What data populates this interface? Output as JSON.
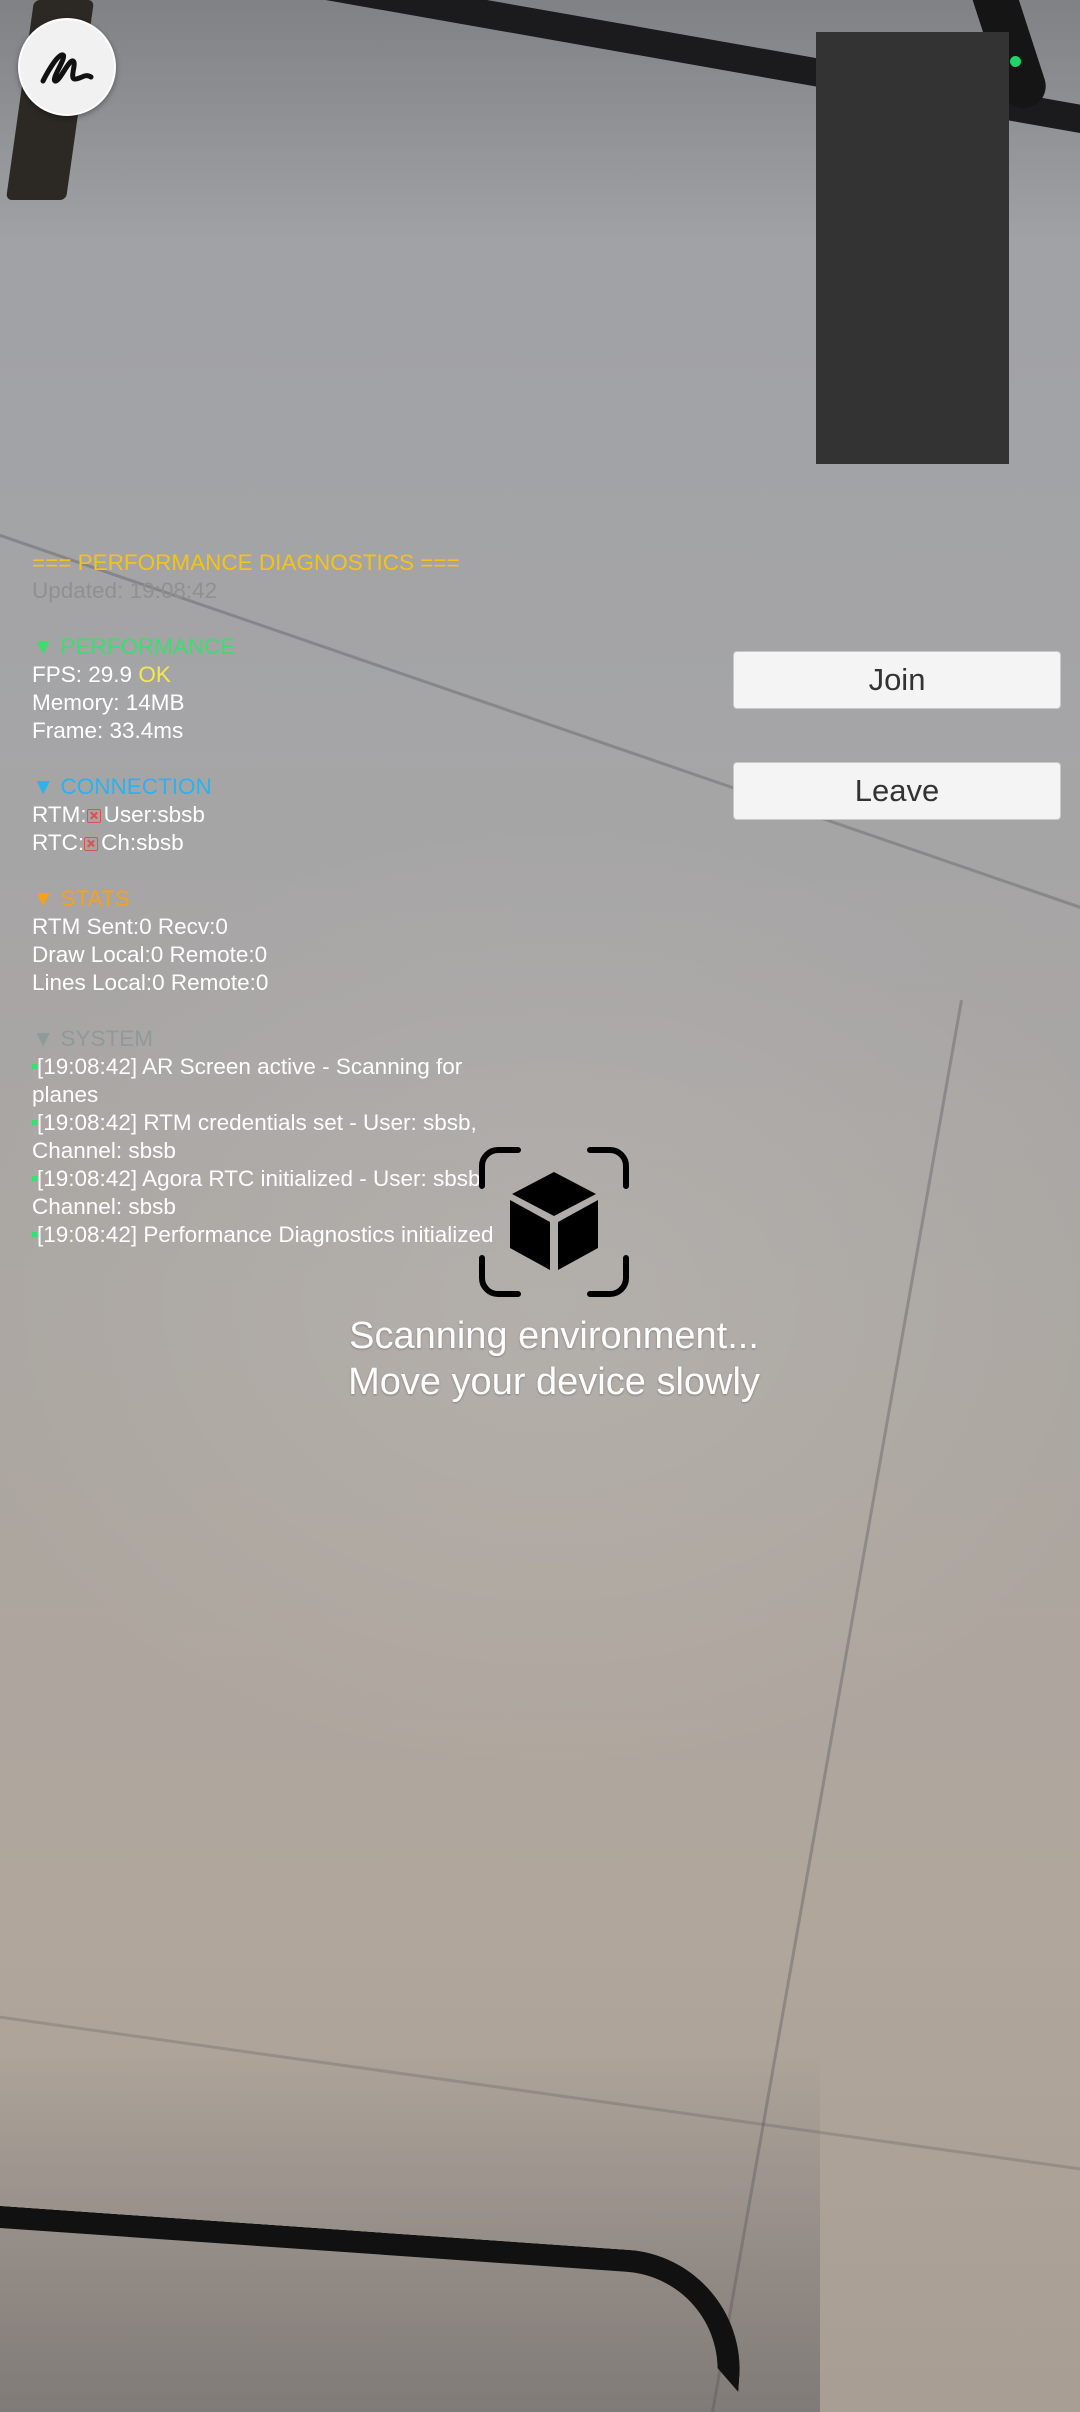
{
  "diagnostics": {
    "header": "=== PERFORMANCE DIAGNOSTICS ===",
    "updated": "Updated: 19:08:42",
    "performance": {
      "heading": "▼ PERFORMANCE",
      "fps_label": "FPS: 29.9",
      "fps_status": "OK",
      "memory": "Memory: 14MB",
      "frame": "Frame: 33.4ms"
    },
    "connection": {
      "heading": "▼ CONNECTION",
      "rtm_label": "RTM:",
      "rtm_value": "User:sbsb",
      "rtc_label": "RTC:",
      "rtc_value": "Ch:sbsb"
    },
    "stats": {
      "heading": "▼ STATS",
      "rtm": "RTM Sent:0 Recv:0",
      "draw": "Draw Local:0 Remote:0",
      "lines": "Lines Local:0 Remote:0"
    },
    "system": {
      "heading": "▼ SYSTEM",
      "logs": [
        "[19:08:42] AR Screen active - Scanning for planes",
        "[19:08:42] RTM credentials set - User: sbsb, Channel: sbsb",
        "[19:08:42] Agora RTC initialized - User: sbsb, Channel: sbsb",
        "[19:08:42] Performance Diagnostics initialized"
      ]
    }
  },
  "buttons": {
    "join": "Join",
    "leave": "Leave"
  },
  "scan": {
    "icon": "ar-cube-scan-icon",
    "line1": "Scanning environment...",
    "line2": "Move your device slowly"
  },
  "brand": {
    "icon": "scribble-logo-icon"
  },
  "remote": {
    "status_color": "#22d36b"
  }
}
